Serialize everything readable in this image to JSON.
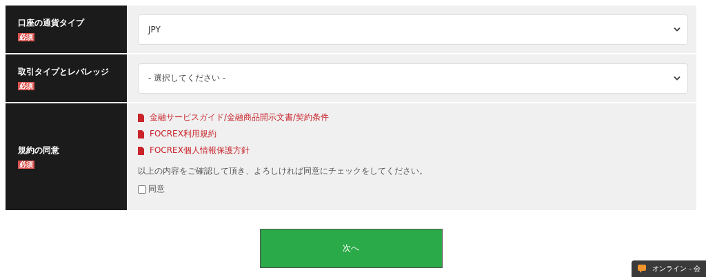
{
  "rows": [
    {
      "label": "口座の通貨タイプ",
      "badge": "必須",
      "kind": "select",
      "value": "JPY"
    },
    {
      "label": "取引タイプとレバレッジ",
      "badge": "必須",
      "kind": "select",
      "placeholder": "- 選択してください -"
    },
    {
      "label": "規約の同意",
      "badge": "必須",
      "kind": "agreement",
      "links": [
        "金融サービスガイド/金融商品開示文書/契約条件",
        "FOCREX利用規約",
        "FOCREX個人情報保護方針"
      ],
      "note": "以上の内容をご確認して頂き、よろしければ同意にチェックをしてください。",
      "checkbox": {
        "label": "同意",
        "checked": false
      }
    }
  ],
  "next_button": "次へ",
  "chat_widget": {
    "label": "オンライン - 会"
  }
}
